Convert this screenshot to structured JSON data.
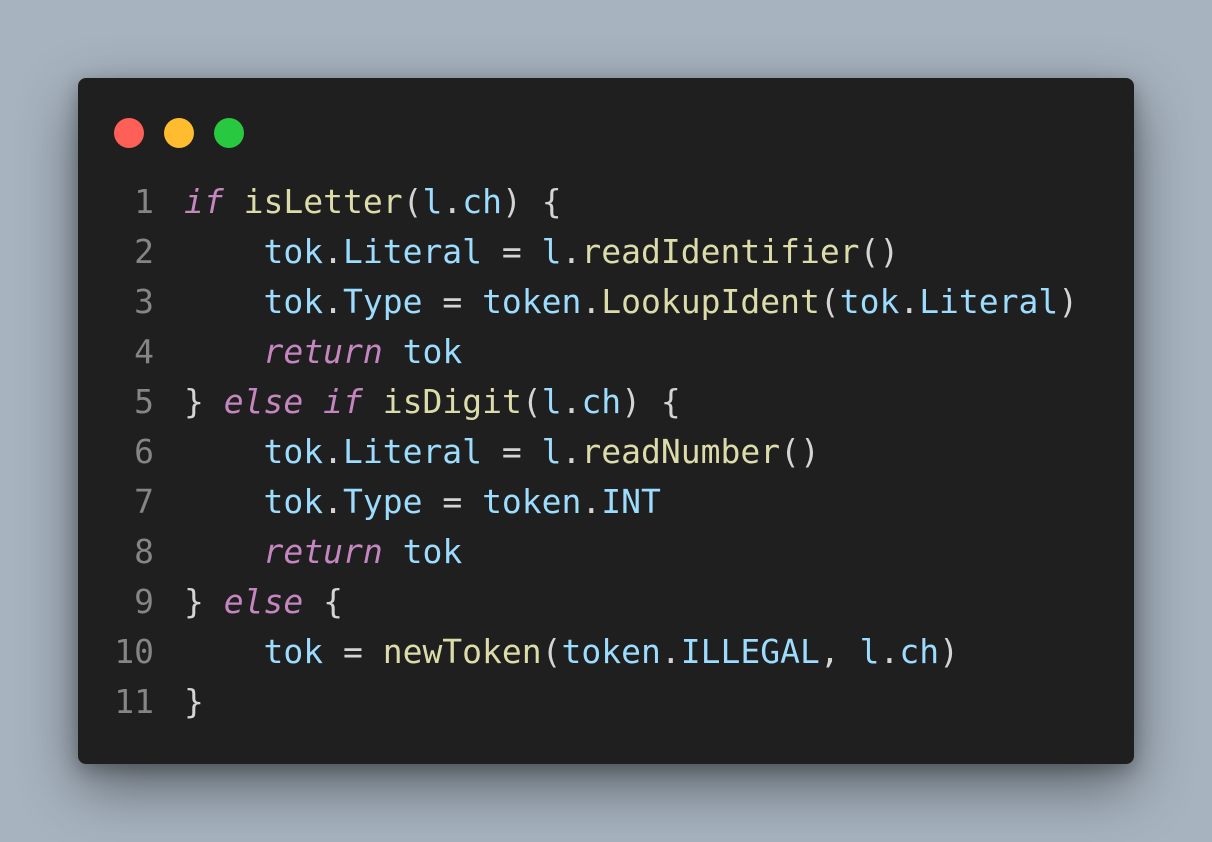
{
  "colors": {
    "background": "#a7b3bf",
    "window": "#1f1f1f",
    "close": "#fe5f57",
    "minimize": "#febc2e",
    "maximize": "#28c840",
    "line_number": "#858585",
    "keyword": "#c586c0",
    "variable": "#9cdcfe",
    "function": "#dcdcaa",
    "punctuation": "#d4d4d4"
  },
  "window_controls": [
    {
      "name": "close",
      "color": "#fe5f57"
    },
    {
      "name": "minimize",
      "color": "#febc2e"
    },
    {
      "name": "maximize",
      "color": "#28c840"
    }
  ],
  "code": {
    "lines": [
      {
        "number": "1",
        "tokens": [
          {
            "text": "if",
            "kind": "kw"
          },
          {
            "text": " ",
            "kind": "p"
          },
          {
            "text": "isLetter",
            "kind": "fn"
          },
          {
            "text": "(",
            "kind": "p"
          },
          {
            "text": "l",
            "kind": "v"
          },
          {
            "text": ".",
            "kind": "p"
          },
          {
            "text": "ch",
            "kind": "v"
          },
          {
            "text": ") {",
            "kind": "p"
          }
        ]
      },
      {
        "number": "2",
        "tokens": [
          {
            "text": "    ",
            "kind": "p"
          },
          {
            "text": "tok",
            "kind": "v"
          },
          {
            "text": ".",
            "kind": "p"
          },
          {
            "text": "Literal",
            "kind": "v"
          },
          {
            "text": " = ",
            "kind": "p"
          },
          {
            "text": "l",
            "kind": "v"
          },
          {
            "text": ".",
            "kind": "p"
          },
          {
            "text": "readIdentifier",
            "kind": "fn"
          },
          {
            "text": "()",
            "kind": "p"
          }
        ]
      },
      {
        "number": "3",
        "tokens": [
          {
            "text": "    ",
            "kind": "p"
          },
          {
            "text": "tok",
            "kind": "v"
          },
          {
            "text": ".",
            "kind": "p"
          },
          {
            "text": "Type",
            "kind": "v"
          },
          {
            "text": " = ",
            "kind": "p"
          },
          {
            "text": "token",
            "kind": "v"
          },
          {
            "text": ".",
            "kind": "p"
          },
          {
            "text": "LookupIdent",
            "kind": "fn"
          },
          {
            "text": "(",
            "kind": "p"
          },
          {
            "text": "tok",
            "kind": "v"
          },
          {
            "text": ".",
            "kind": "p"
          },
          {
            "text": "Literal",
            "kind": "v"
          },
          {
            "text": ")",
            "kind": "p"
          }
        ]
      },
      {
        "number": "4",
        "tokens": [
          {
            "text": "    ",
            "kind": "p"
          },
          {
            "text": "return",
            "kind": "kw"
          },
          {
            "text": " ",
            "kind": "p"
          },
          {
            "text": "tok",
            "kind": "v"
          }
        ]
      },
      {
        "number": "5",
        "tokens": [
          {
            "text": "} ",
            "kind": "p"
          },
          {
            "text": "else",
            "kind": "kw"
          },
          {
            "text": " ",
            "kind": "p"
          },
          {
            "text": "if",
            "kind": "kw"
          },
          {
            "text": " ",
            "kind": "p"
          },
          {
            "text": "isDigit",
            "kind": "fn"
          },
          {
            "text": "(",
            "kind": "p"
          },
          {
            "text": "l",
            "kind": "v"
          },
          {
            "text": ".",
            "kind": "p"
          },
          {
            "text": "ch",
            "kind": "v"
          },
          {
            "text": ") {",
            "kind": "p"
          }
        ]
      },
      {
        "number": "6",
        "tokens": [
          {
            "text": "    ",
            "kind": "p"
          },
          {
            "text": "tok",
            "kind": "v"
          },
          {
            "text": ".",
            "kind": "p"
          },
          {
            "text": "Literal",
            "kind": "v"
          },
          {
            "text": " = ",
            "kind": "p"
          },
          {
            "text": "l",
            "kind": "v"
          },
          {
            "text": ".",
            "kind": "p"
          },
          {
            "text": "readNumber",
            "kind": "fn"
          },
          {
            "text": "()",
            "kind": "p"
          }
        ]
      },
      {
        "number": "7",
        "tokens": [
          {
            "text": "    ",
            "kind": "p"
          },
          {
            "text": "tok",
            "kind": "v"
          },
          {
            "text": ".",
            "kind": "p"
          },
          {
            "text": "Type",
            "kind": "v"
          },
          {
            "text": " = ",
            "kind": "p"
          },
          {
            "text": "token",
            "kind": "v"
          },
          {
            "text": ".",
            "kind": "p"
          },
          {
            "text": "INT",
            "kind": "v"
          }
        ]
      },
      {
        "number": "8",
        "tokens": [
          {
            "text": "    ",
            "kind": "p"
          },
          {
            "text": "return",
            "kind": "kw"
          },
          {
            "text": " ",
            "kind": "p"
          },
          {
            "text": "tok",
            "kind": "v"
          }
        ]
      },
      {
        "number": "9",
        "tokens": [
          {
            "text": "} ",
            "kind": "p"
          },
          {
            "text": "else",
            "kind": "kw"
          },
          {
            "text": " {",
            "kind": "p"
          }
        ]
      },
      {
        "number": "10",
        "tokens": [
          {
            "text": "    ",
            "kind": "p"
          },
          {
            "text": "tok",
            "kind": "v"
          },
          {
            "text": " = ",
            "kind": "p"
          },
          {
            "text": "newToken",
            "kind": "fn"
          },
          {
            "text": "(",
            "kind": "p"
          },
          {
            "text": "token",
            "kind": "v"
          },
          {
            "text": ".",
            "kind": "p"
          },
          {
            "text": "ILLEGAL",
            "kind": "v"
          },
          {
            "text": ", ",
            "kind": "p"
          },
          {
            "text": "l",
            "kind": "v"
          },
          {
            "text": ".",
            "kind": "p"
          },
          {
            "text": "ch",
            "kind": "v"
          },
          {
            "text": ")",
            "kind": "p"
          }
        ]
      },
      {
        "number": "11",
        "tokens": [
          {
            "text": "}",
            "kind": "p"
          }
        ]
      }
    ]
  }
}
